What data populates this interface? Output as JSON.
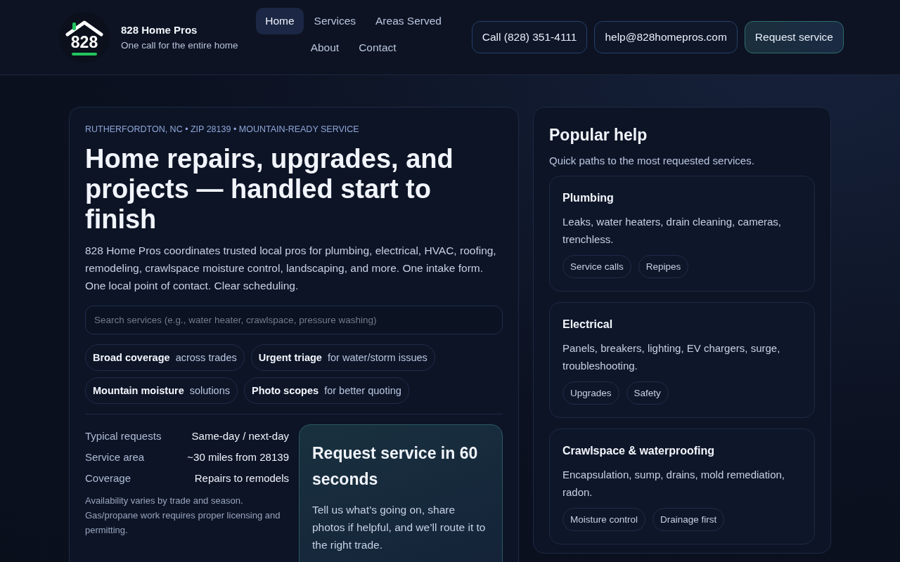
{
  "header": {
    "logo_mark": "828",
    "brand": "828 Home Pros",
    "tagline": "One call for the entire home",
    "nav": [
      {
        "label": "Home",
        "selected": true
      },
      {
        "label": "Services",
        "selected": false
      },
      {
        "label": "Areas Served",
        "selected": false
      },
      {
        "label": "About",
        "selected": false
      },
      {
        "label": "Contact",
        "selected": false
      }
    ],
    "actions": [
      {
        "label": "Call (828) 351-4111",
        "kind": "outline"
      },
      {
        "label": "help@828homepros.com",
        "kind": "outline"
      },
      {
        "label": "Request service",
        "kind": "primary"
      }
    ]
  },
  "hero": {
    "eyebrow": "RUTHERFORDTON, NC • ZIP 28139 • MOUNTAIN-READY SERVICE",
    "title": "Home repairs, upgrades, and projects — handled start to finish",
    "lead": "828 Home Pros coordinates trusted local pros for plumbing, electrical, HVAC, roofing, remodeling, crawlspace moisture control, landscaping, and more. One intake form. One local point of contact. Clear scheduling.",
    "search": {
      "placeholder": "Search services (e.g., water heater, crawlspace, pressure washing)"
    },
    "highlights": [
      "**Broad coverage**  across trades",
      "**Urgent triage**  for water/storm issues",
      "**Mountain moisture**  solutions",
      "**Photo scopes**  for better quoting"
    ],
    "stats": [
      {
        "label": "Typical requests",
        "value": "Same-day / next-day"
      },
      {
        "label": "Service area",
        "value": "~30 miles from 28139"
      },
      {
        "label": "Coverage",
        "value": "Repairs to remodels"
      }
    ],
    "note": "Availability varies by trade and season. Gas/propane work requires proper licensing and permitting.",
    "request_card": {
      "title": "Request service in 60 seconds",
      "text": "Tell us what’s going on, share photos if helpful, and we’ll route it to the right trade."
    }
  },
  "popular": {
    "title": "Popular help",
    "subtitle": "Quick paths to the most requested services.",
    "cards": [
      {
        "title": "Plumbing",
        "text": "Leaks, water heaters, drain cleaning, cameras, trenchless.",
        "tags": [
          "Service calls",
          "Repipes"
        ]
      },
      {
        "title": "Electrical",
        "text": "Panels, breakers, lighting, EV chargers, surge, troubleshooting.",
        "tags": [
          "Upgrades",
          "Safety"
        ]
      },
      {
        "title": "Crawlspace & waterproofing",
        "text": "Encapsulation, sump, drains, mold remediation, radon.",
        "tags": [
          "Moisture control",
          "Drainage first"
        ]
      }
    ]
  }
}
